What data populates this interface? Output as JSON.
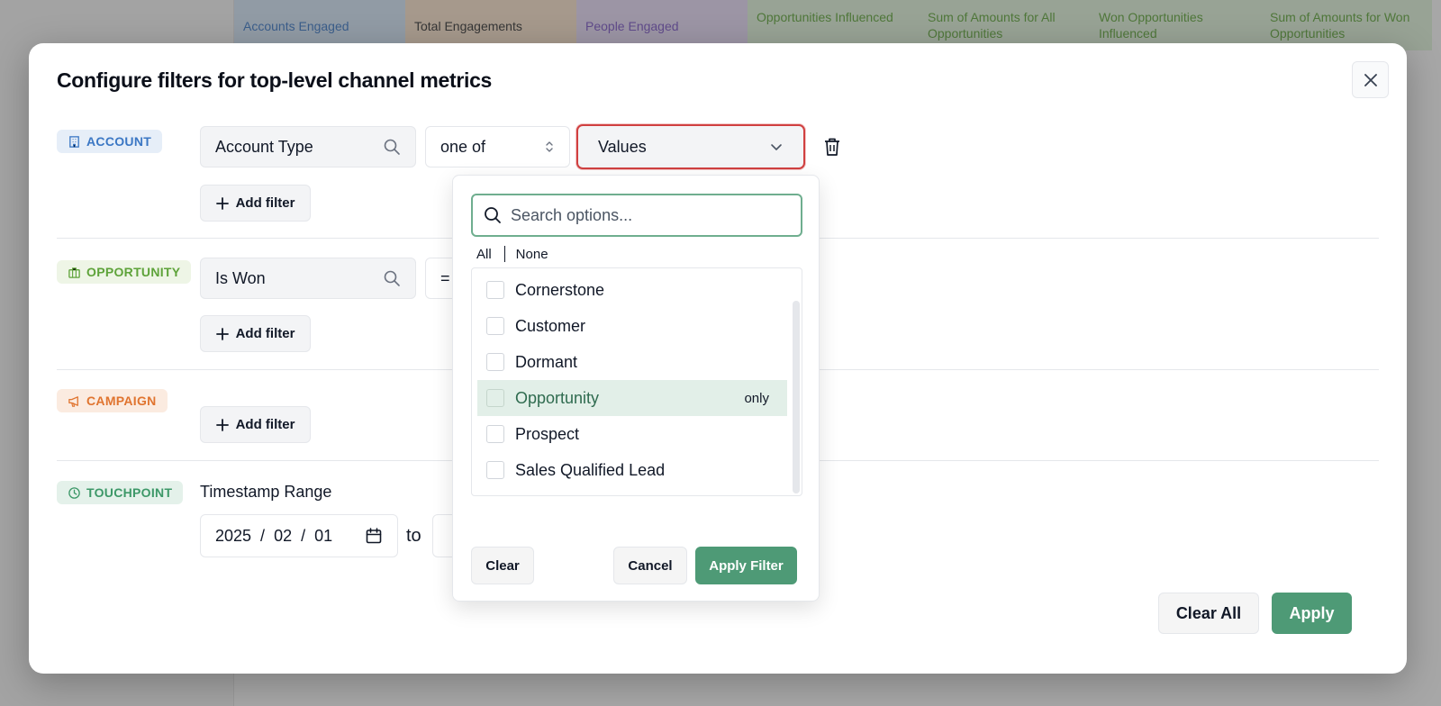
{
  "background": {
    "columns": [
      {
        "label": "Accounts Engaged",
        "bg": "#cfe0f2",
        "color": "#3b77c4"
      },
      {
        "label": "Total Engagements",
        "bg": "#f3dcc7",
        "color": "#333333"
      },
      {
        "label": "People Engaged",
        "bg": "#e2d6f1",
        "color": "#7b56c4"
      },
      {
        "label": "Opportunities Influenced",
        "bg": "#dbeed6",
        "color": "#5ea33a"
      },
      {
        "label": "Sum of Amounts for All Opportunities",
        "bg": "#dbeed6",
        "color": "#5ea33a"
      },
      {
        "label": "Won Opportunities Influenced",
        "bg": "#dbeed6",
        "color": "#5ea33a"
      },
      {
        "label": "Sum of Amounts for Won Opportunities",
        "bg": "#dbeed6",
        "color": "#5ea33a"
      }
    ]
  },
  "modal": {
    "title": "Configure filters for top-level channel metrics",
    "close_icon": "close-icon"
  },
  "sections": {
    "account": {
      "tag": "ACCOUNT",
      "icon": "building-icon",
      "field": "Account Type",
      "operator": "one of",
      "values_placeholder": "Values",
      "add_filter": "Add filter"
    },
    "opportunity": {
      "tag": "OPPORTUNITY",
      "icon": "briefcase-icon",
      "field": "Is Won",
      "operator": "=",
      "add_filter": "Add filter"
    },
    "campaign": {
      "tag": "CAMPAIGN",
      "icon": "megaphone-icon",
      "add_filter": "Add filter"
    },
    "touchpoint": {
      "tag": "TOUCHPOINT",
      "icon": "clock-icon",
      "range_label": "Timestamp Range",
      "from_date": {
        "year": "2025",
        "month": "02",
        "day": "01"
      },
      "to_label": "to"
    }
  },
  "dropdown": {
    "search_placeholder": "Search options...",
    "all_label": "All",
    "none_label": "None",
    "options": [
      {
        "label": "Cornerstone",
        "checked": false
      },
      {
        "label": "Customer",
        "checked": false
      },
      {
        "label": "Dormant",
        "checked": false
      },
      {
        "label": "Opportunity",
        "checked": false,
        "hovered": true,
        "only_label": "only"
      },
      {
        "label": "Prospect",
        "checked": false
      },
      {
        "label": "Sales Qualified Lead",
        "checked": false
      }
    ],
    "clear_label": "Clear",
    "cancel_label": "Cancel",
    "apply_label": "Apply Filter"
  },
  "footer": {
    "clear_all_label": "Clear All",
    "apply_label": "Apply"
  },
  "colors": {
    "primary_green": "#4e9a76",
    "error_red": "#d04040"
  }
}
